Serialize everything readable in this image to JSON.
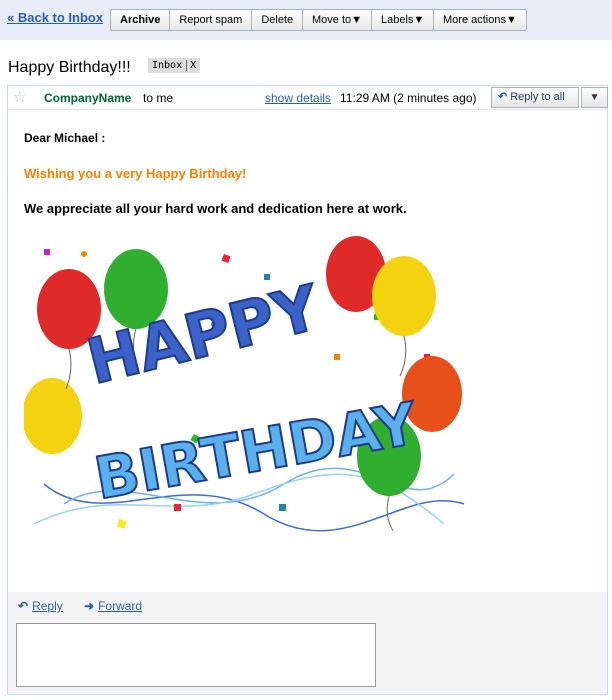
{
  "toolbar": {
    "back_label": "« Back to Inbox",
    "buttons_group1": [
      "Archive",
      "Report spam",
      "Delete"
    ],
    "move_to": "Move to▼",
    "labels": "Labels▼",
    "more_actions": "More actions▼"
  },
  "subject": {
    "title": "Happy Birthday!!!",
    "label": "Inbox",
    "label_remove": "X"
  },
  "message": {
    "sender": "CompanyName",
    "recipient": "to me",
    "show_details": "show details",
    "time": "11:29 AM (2 minutes ago)",
    "reply_all": "Reply to all",
    "more_icon": "▼",
    "greeting": "Dear Michael :",
    "wish": "Wishing you a very Happy Birthday!",
    "appreciation": "We appreciate all your hard work and dedication here at work.",
    "colors": {
      "wish": "#ff8000",
      "sender": "#006633",
      "link": "#2a5db0"
    }
  },
  "footer": {
    "reply": "Reply",
    "forward": "Forward"
  },
  "image": {
    "letters_top": "HAPPY",
    "letters_bottom": "BIRTHDAY"
  }
}
